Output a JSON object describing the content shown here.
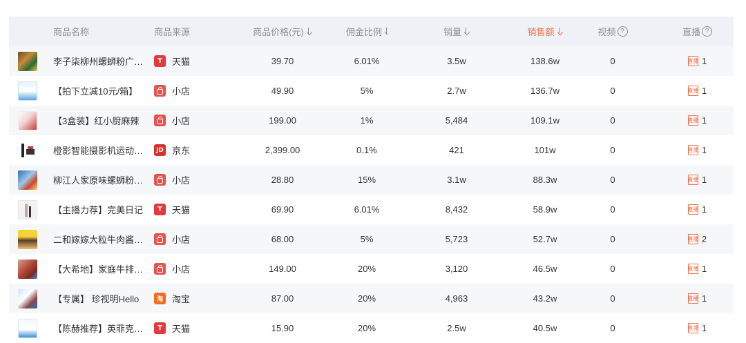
{
  "headers": {
    "name": "商品名称",
    "source": "商品来源",
    "price": "商品价格(元)",
    "commission": "佣金比例",
    "quantity": "销量",
    "sales": "销售额",
    "video": "视频",
    "live": "直播",
    "question_mark": "?"
  },
  "colors": {
    "accent": "#f0714a",
    "header_bg": "#eef1f6",
    "tmall": "#e4393c",
    "taobao": "#f46d1f"
  },
  "live_icon_text": "直播",
  "rows": [
    {
      "name": "李子柒柳州螺蛳粉广西特产",
      "source": "天猫",
      "source_type": "tmall",
      "source_icon": "T",
      "price": "39.70",
      "commission": "6.01%",
      "quantity": "3.5w",
      "sales": "138.6w",
      "video": "0",
      "live": "1"
    },
    {
      "name": "【拍下立减10元/箱】",
      "source": "小店",
      "source_type": "shop",
      "source_icon": "",
      "price": "49.90",
      "commission": "5%",
      "quantity": "2.7w",
      "sales": "136.7w",
      "video": "0",
      "live": "1"
    },
    {
      "name": "【3盒装】红小厨麻辣",
      "source": "小店",
      "source_type": "shop",
      "source_icon": "",
      "price": "199.00",
      "commission": "1%",
      "quantity": "5,484",
      "sales": "109.1w",
      "video": "0",
      "live": "1"
    },
    {
      "name": "橙影智能摄影机运动相机",
      "source": "京东",
      "source_type": "jd",
      "source_icon": "JD",
      "price": "2,399.00",
      "commission": "0.1%",
      "quantity": "421",
      "sales": "101w",
      "video": "0",
      "live": "1"
    },
    {
      "name": "柳江人家原味螺蛳粉广西",
      "source": "小店",
      "source_type": "shop",
      "source_icon": "",
      "price": "28.80",
      "commission": "15%",
      "quantity": "3.1w",
      "sales": "88.3w",
      "video": "0",
      "live": "1"
    },
    {
      "name": "【主播力荐】完美日记",
      "source": "天猫",
      "source_type": "tmall",
      "source_icon": "T",
      "price": "69.90",
      "commission": "6.01%",
      "quantity": "8,432",
      "sales": "58.9w",
      "video": "0",
      "live": "1"
    },
    {
      "name": "二和嫁嫁大粒牛肉酱拌饭",
      "source": "小店",
      "source_type": "shop",
      "source_icon": "",
      "price": "68.00",
      "commission": "5%",
      "quantity": "5,723",
      "sales": "52.7w",
      "video": "0",
      "live": "2"
    },
    {
      "name": "【大希地】家庭牛排套餐",
      "source": "小店",
      "source_type": "shop",
      "source_icon": "",
      "price": "149.00",
      "commission": "20%",
      "quantity": "3,120",
      "sales": "46.5w",
      "video": "0",
      "live": "1"
    },
    {
      "name": "【专属】 珍视明Hello",
      "source": "淘宝",
      "source_type": "taobao",
      "source_icon": "淘",
      "price": "87.00",
      "commission": "20%",
      "quantity": "4,963",
      "sales": "43.2w",
      "video": "0",
      "live": "1"
    },
    {
      "name": "【陈赫推荐】英菲克电动",
      "source": "天猫",
      "source_type": "tmall",
      "source_icon": "T",
      "price": "15.90",
      "commission": "20%",
      "quantity": "2.5w",
      "sales": "40.5w",
      "video": "0",
      "live": "1"
    }
  ]
}
